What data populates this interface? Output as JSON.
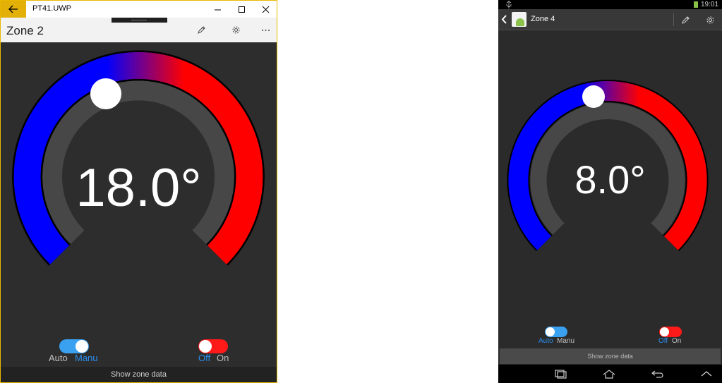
{
  "uwp": {
    "window_title": "PT41.UWP",
    "zone_title": "Zone 2",
    "temperature": "18.0°",
    "setpoint_value": 18.0,
    "mode_toggle": {
      "left_label": "Auto",
      "right_label": "Manu",
      "state": "Manu"
    },
    "power_toggle": {
      "left_label": "Off",
      "right_label": "On",
      "state": "Off"
    },
    "footer_label": "Show zone data"
  },
  "android": {
    "status_time": "19:01",
    "zone_title": "Zone 4",
    "temperature": "8.0°",
    "setpoint_value": 8.0,
    "mode_toggle": {
      "left_label": "Auto",
      "right_label": "Manu",
      "state": "Auto"
    },
    "power_toggle": {
      "left_label": "Off",
      "right_label": "On",
      "state": "Off"
    },
    "footer_label": "Show zone data"
  },
  "colors": {
    "cold": "#0000ff",
    "hot": "#ff0000",
    "accent_blue": "#1e90ff",
    "toggle_blue": "#3aa0f0",
    "toggle_red": "#ff1a1a",
    "uwp_titlebar_accent": "#e2b007"
  },
  "icons": {
    "uwp_back": "arrow-left-icon",
    "uwp_minimize": "minimize-icon",
    "uwp_maximize": "maximize-icon",
    "uwp_close": "close-icon",
    "uwp_edit": "pencil-icon",
    "uwp_settings": "gear-icon",
    "uwp_more": "more-icon",
    "android_back": "chevron-left-icon",
    "android_edit": "pencil-icon",
    "android_settings": "gear-icon",
    "nav_recents": "recents-icon",
    "nav_home": "home-icon",
    "nav_back": "back-icon",
    "nav_up": "chevron-up-icon"
  }
}
